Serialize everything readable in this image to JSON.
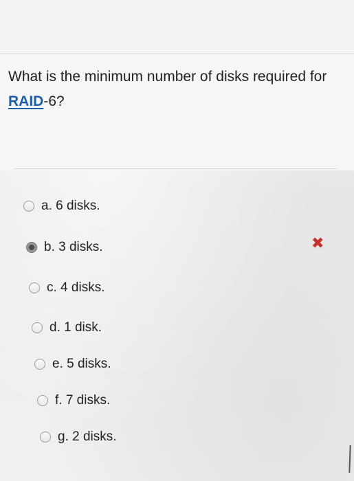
{
  "question": {
    "prefix": "What is the minimum number of disks required for ",
    "link_text": "RAID",
    "suffix": "-6?"
  },
  "options": [
    {
      "label": "a. 6 disks.",
      "selected": false
    },
    {
      "label": "b. 3 disks.",
      "selected": true
    },
    {
      "label": "c. 4 disks.",
      "selected": false
    },
    {
      "label": "d. 1 disk.",
      "selected": false
    },
    {
      "label": "e. 5 disks.",
      "selected": false
    },
    {
      "label": "f. 7 disks.",
      "selected": false
    },
    {
      "label": "g. 2 disks.",
      "selected": false
    }
  ],
  "feedback": {
    "incorrect_icon": "x-mark-icon",
    "incorrect_color": "#c4302b"
  },
  "colors": {
    "link": "#1f5fa8"
  }
}
